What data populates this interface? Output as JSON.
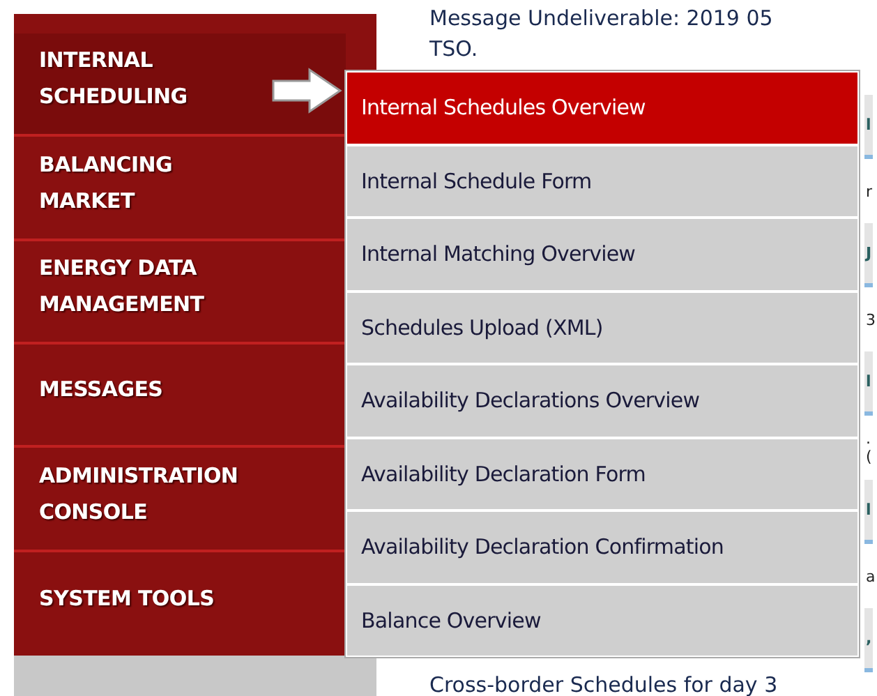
{
  "sidebar": {
    "items": [
      {
        "label": "INTERNAL SCHEDULING",
        "selected": true
      },
      {
        "label": "BALANCING MARKET",
        "selected": false
      },
      {
        "label": "ENERGY DATA MANAGEMENT",
        "selected": false
      },
      {
        "label": "MESSAGES",
        "selected": false
      },
      {
        "label": "ADMINISTRATION CONSOLE",
        "selected": false
      },
      {
        "label": "SYSTEM TOOLS",
        "selected": false
      }
    ]
  },
  "submenu": {
    "items": [
      {
        "label": "Internal Schedules Overview",
        "selected": true
      },
      {
        "label": "Internal Schedule Form",
        "selected": false
      },
      {
        "label": "Internal Matching Overview",
        "selected": false
      },
      {
        "label": "Schedules Upload (XML)",
        "selected": false
      },
      {
        "label": "Availability Declarations Overview",
        "selected": false
      },
      {
        "label": "Availability Declaration Form",
        "selected": false
      },
      {
        "label": "Availability Declaration Confirmation",
        "selected": false
      },
      {
        "label": "Balance Overview",
        "selected": false
      }
    ]
  },
  "content": {
    "message": "Message Undeliverable: 2019 05",
    "message_end": "TSO.",
    "fragments": [
      {
        "kind": "header",
        "text": "l"
      },
      {
        "kind": "text",
        "text": "r"
      },
      {
        "kind": "header",
        "text": "J"
      },
      {
        "kind": "text",
        "text": "3"
      },
      {
        "kind": "header",
        "text": "l"
      },
      {
        "kind": "text",
        "text": ".("
      },
      {
        "kind": "header",
        "text": "l"
      },
      {
        "kind": "text",
        "text": "a"
      },
      {
        "kind": "header",
        "text": ","
      }
    ],
    "footer_text": "Cross-border Schedules for day 3"
  }
}
